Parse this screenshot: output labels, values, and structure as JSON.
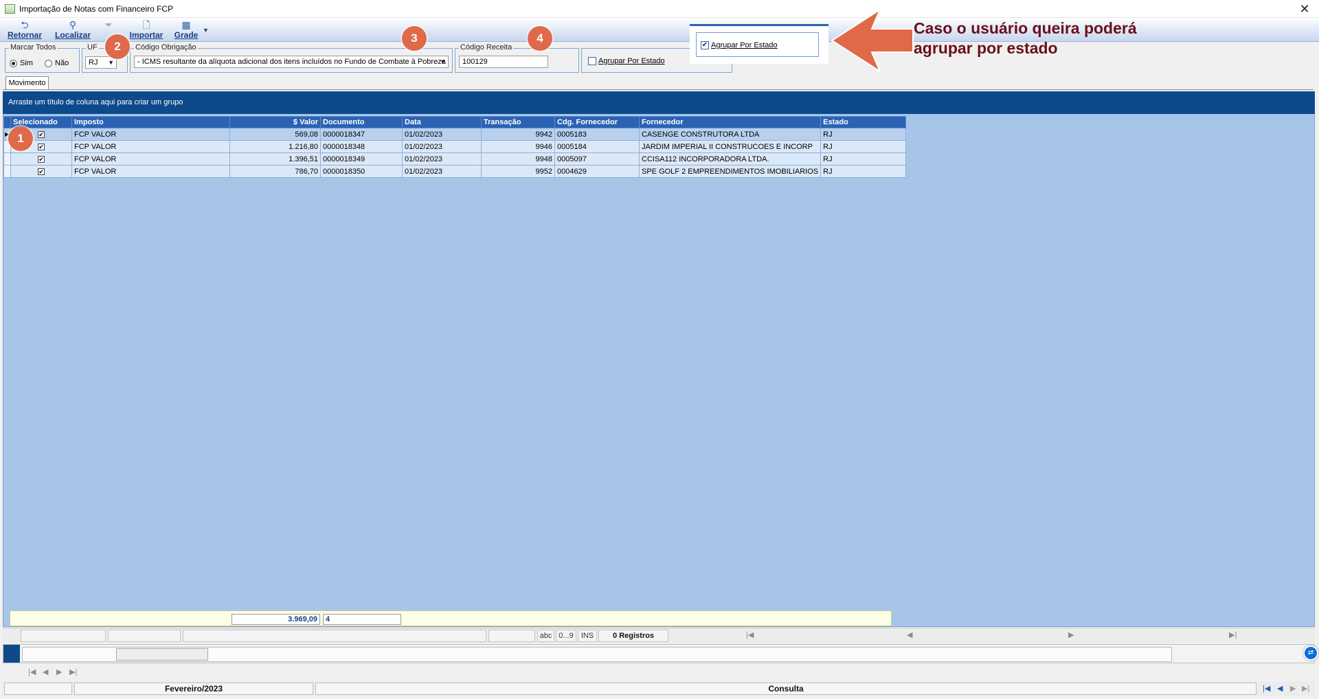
{
  "window": {
    "title": "Importação de Notas com Financeiro FCP",
    "close_glyph": "✕"
  },
  "toolbar": {
    "buttons": [
      {
        "label": "Retornar",
        "icon": "undo-icon"
      },
      {
        "label": "Localizar",
        "icon": "search-icon"
      },
      {
        "label": "",
        "icon": "filter-icon"
      },
      {
        "label": "Importar",
        "icon": "document-icon"
      },
      {
        "label": "Grade",
        "icon": "grid-icon"
      }
    ]
  },
  "filters": {
    "marcar_todos": {
      "legend": "Marcar Todos",
      "options": [
        "Sim",
        "Não"
      ],
      "selected": "Sim"
    },
    "uf": {
      "legend": "UF",
      "value": "RJ"
    },
    "codigo_obrigacao": {
      "legend": "Código Obrigação",
      "value": "- ICMS resultante da alíquota adicional dos itens incluídos no Fundo de Combate à Pobreza"
    },
    "codigo_receita": {
      "legend": "Código Receita",
      "value": "100129"
    },
    "agrupar": {
      "label": "Agrupar Por Estado",
      "checked": false
    }
  },
  "callout": {
    "checkbox_label": "Agrupar Por Estado",
    "checked": true,
    "text": "Caso o usuário queira poderá agrupar por estado",
    "arrow_color": "#e0694a",
    "text_color": "#6b0f1a"
  },
  "badges": [
    "1",
    "2",
    "3",
    "4"
  ],
  "tab": {
    "label": "Movimento"
  },
  "grid": {
    "group_hint": "Arraste um título de coluna aqui para criar um grupo",
    "columns": [
      "Selecionado",
      "Imposto",
      "$ Valor",
      "Documento",
      "Data",
      "Transação",
      "Cdg. Fornecedor",
      "Fornecedor",
      "Estado"
    ],
    "rows": [
      {
        "selecionado": true,
        "imposto": "FCP VALOR",
        "valor": "569,08",
        "documento": "0000018347",
        "data": "01/02/2023",
        "transacao": "9942",
        "cdg_fornecedor": "0005183",
        "fornecedor": "CASENGE CONSTRUTORA LTDA",
        "estado": "RJ"
      },
      {
        "selecionado": true,
        "imposto": "FCP VALOR",
        "valor": "1.216,80",
        "documento": "0000018348",
        "data": "01/02/2023",
        "transacao": "9946",
        "cdg_fornecedor": "0005184",
        "fornecedor": "JARDIM IMPERIAL II CONSTRUCOES E INCORP",
        "estado": "RJ"
      },
      {
        "selecionado": true,
        "imposto": "FCP VALOR",
        "valor": "1.396,51",
        "documento": "0000018349",
        "data": "01/02/2023",
        "transacao": "9948",
        "cdg_fornecedor": "0005097",
        "fornecedor": "CCISA112 INCORPORADORA LTDA.",
        "estado": "RJ"
      },
      {
        "selecionado": true,
        "imposto": "FCP VALOR",
        "valor": "786,70",
        "documento": "0000018350",
        "data": "01/02/2023",
        "transacao": "9952",
        "cdg_fornecedor": "0004629",
        "fornecedor": "SPE GOLF 2 EMPREENDIMENTOS IMOBILIARIOS",
        "estado": "RJ"
      }
    ],
    "totals": {
      "valor": "3.969,09",
      "count": "4"
    }
  },
  "statusbar": {
    "abc": "abc",
    "digits": "0...9",
    "ins": "INS",
    "registros": "0 Registros",
    "periodo": "Fevereiro/2023",
    "modo": "Consulta"
  },
  "colors": {
    "accent": "#2b62b3",
    "group_bar": "#0d4a8c",
    "grid_bg": "#a6c5e9",
    "badge": "#e0694a"
  }
}
